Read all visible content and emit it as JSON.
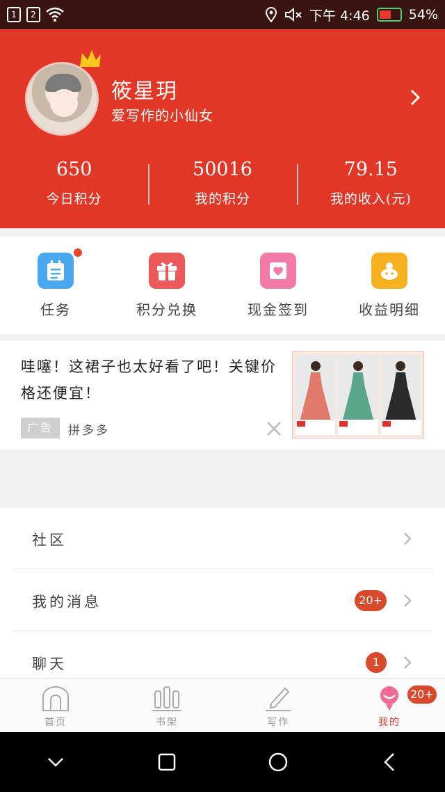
{
  "status_bar": {
    "sim1": "1",
    "sim2": "2",
    "time": "下午 4:46",
    "battery": "54%",
    "battery_level": 0.54,
    "icons": [
      "sim-1-icon",
      "sim-2-icon",
      "wifi-icon",
      "location-icon",
      "mute-icon",
      "battery-icon"
    ]
  },
  "profile": {
    "name": "筱星玥",
    "bio": "爱写作的小仙女",
    "stats": [
      {
        "value": "650",
        "label": "今日积分"
      },
      {
        "value": "50016",
        "label": "我的积分"
      },
      {
        "value": "79.15",
        "label": "我的收入(元)"
      }
    ]
  },
  "actions": [
    {
      "label": "任务",
      "icon": "task-icon",
      "color": "#4aa8f0",
      "dot": true
    },
    {
      "label": "积分兑换",
      "icon": "gift-icon",
      "color": "#ee5a5a",
      "dot": false
    },
    {
      "label": "现金签到",
      "icon": "checkin-icon",
      "color": "#f27aa8",
      "dot": false
    },
    {
      "label": "收益明细",
      "icon": "piggy-icon",
      "color": "#f5b21e",
      "dot": false
    }
  ],
  "ad": {
    "text": "哇噻！这裙子也太好看了吧！关键价格还便宜！",
    "tag": "广告",
    "source": "拼多多",
    "dress_colors": [
      "#e07a6a",
      "#5aa68a",
      "#2a2a2a"
    ]
  },
  "menu": [
    {
      "label": "社区",
      "badge": null
    },
    {
      "label": "我的消息",
      "badge": "20+"
    },
    {
      "label": "聊天",
      "badge": "1"
    }
  ],
  "tabs": [
    {
      "label": "首页",
      "icon": "home-icon",
      "active": false
    },
    {
      "label": "书架",
      "icon": "bookshelf-icon",
      "active": false
    },
    {
      "label": "写作",
      "icon": "pen-icon",
      "active": false
    },
    {
      "label": "我的",
      "icon": "profile-icon",
      "active": true,
      "badge": "20+"
    }
  ],
  "colors": {
    "brand": "#e23626",
    "badge": "#d9492c",
    "active_tab": "#e53a2c"
  }
}
